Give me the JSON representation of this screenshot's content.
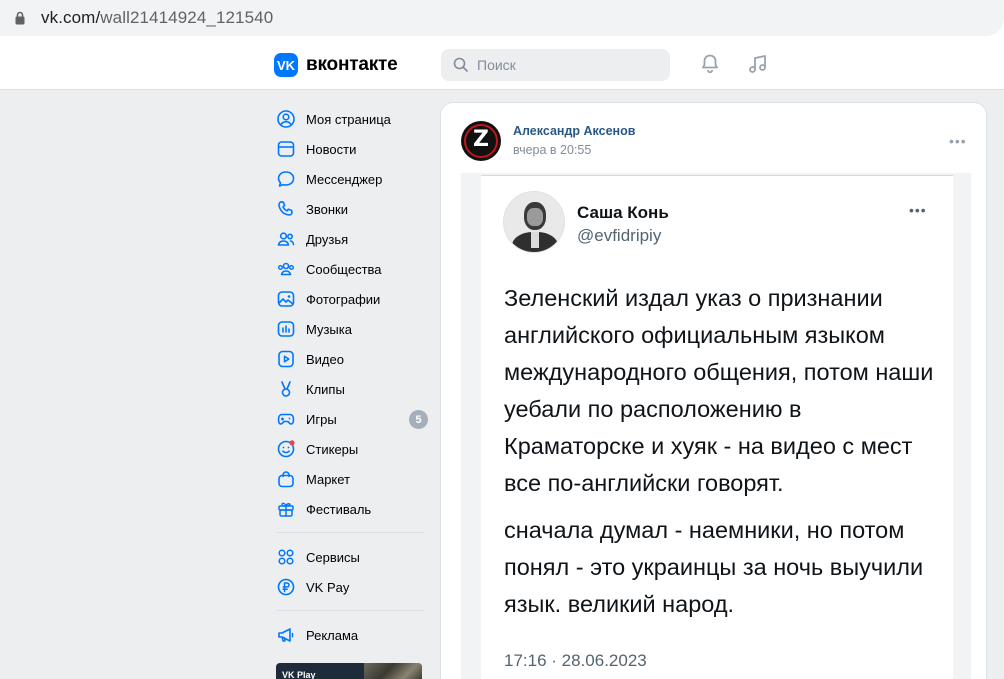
{
  "browser": {
    "url_host": "vk.com/",
    "url_path": "wall21414924_121540"
  },
  "header": {
    "logo_mark": "VK",
    "logo_text": "вконтакте",
    "search_placeholder": "Поиск",
    "icons": [
      "bell-icon",
      "music-note-icon"
    ]
  },
  "sidebar": {
    "items": [
      {
        "label": "Моя страница",
        "icon": "user-circle-icon"
      },
      {
        "label": "Новости",
        "icon": "newsfeed-icon"
      },
      {
        "label": "Мессенджер",
        "icon": "message-bubble-icon"
      },
      {
        "label": "Звонки",
        "icon": "phone-icon"
      },
      {
        "label": "Друзья",
        "icon": "friends-icon"
      },
      {
        "label": "Сообщества",
        "icon": "communities-icon"
      },
      {
        "label": "Фотографии",
        "icon": "photo-icon"
      },
      {
        "label": "Музыка",
        "icon": "music-icon"
      },
      {
        "label": "Видео",
        "icon": "video-icon"
      },
      {
        "label": "Клипы",
        "icon": "clips-icon"
      },
      {
        "label": "Игры",
        "icon": "gamepad-icon",
        "badge": "5"
      },
      {
        "label": "Стикеры",
        "icon": "sticker-icon"
      },
      {
        "label": "Маркет",
        "icon": "market-bag-icon"
      },
      {
        "label": "Фестиваль",
        "icon": "gift-icon"
      }
    ],
    "items2": [
      {
        "label": "Сервисы",
        "icon": "services-grid-icon"
      },
      {
        "label": "VK Pay",
        "icon": "ruble-icon"
      }
    ],
    "items3": [
      {
        "label": "Реклама",
        "icon": "megaphone-icon"
      }
    ],
    "promo_label": "VK Play"
  },
  "post": {
    "author": "Александр Аксенов",
    "time": "вчера в 20:55",
    "avatar_letter": "Z"
  },
  "tweet": {
    "name": "Саша Конь",
    "handle": "@evfidripiy",
    "paragraph1": "Зеленский издал указ о признании английского официальным языком международного общения, потом наши уебали по расположению в Краматорске и хуяк - на видео с мест все по-английски говорят.",
    "paragraph2": "сначала думал - наемники, но потом понял - это украинцы за ночь выучили язык. великий народ.",
    "date": "17:16 · 28.06.2023"
  },
  "colors": {
    "brand": "#0077ff",
    "link": "#2a5885",
    "muted": "#818c99",
    "badge": "#a5afba",
    "page_bg": "#edeef0"
  }
}
